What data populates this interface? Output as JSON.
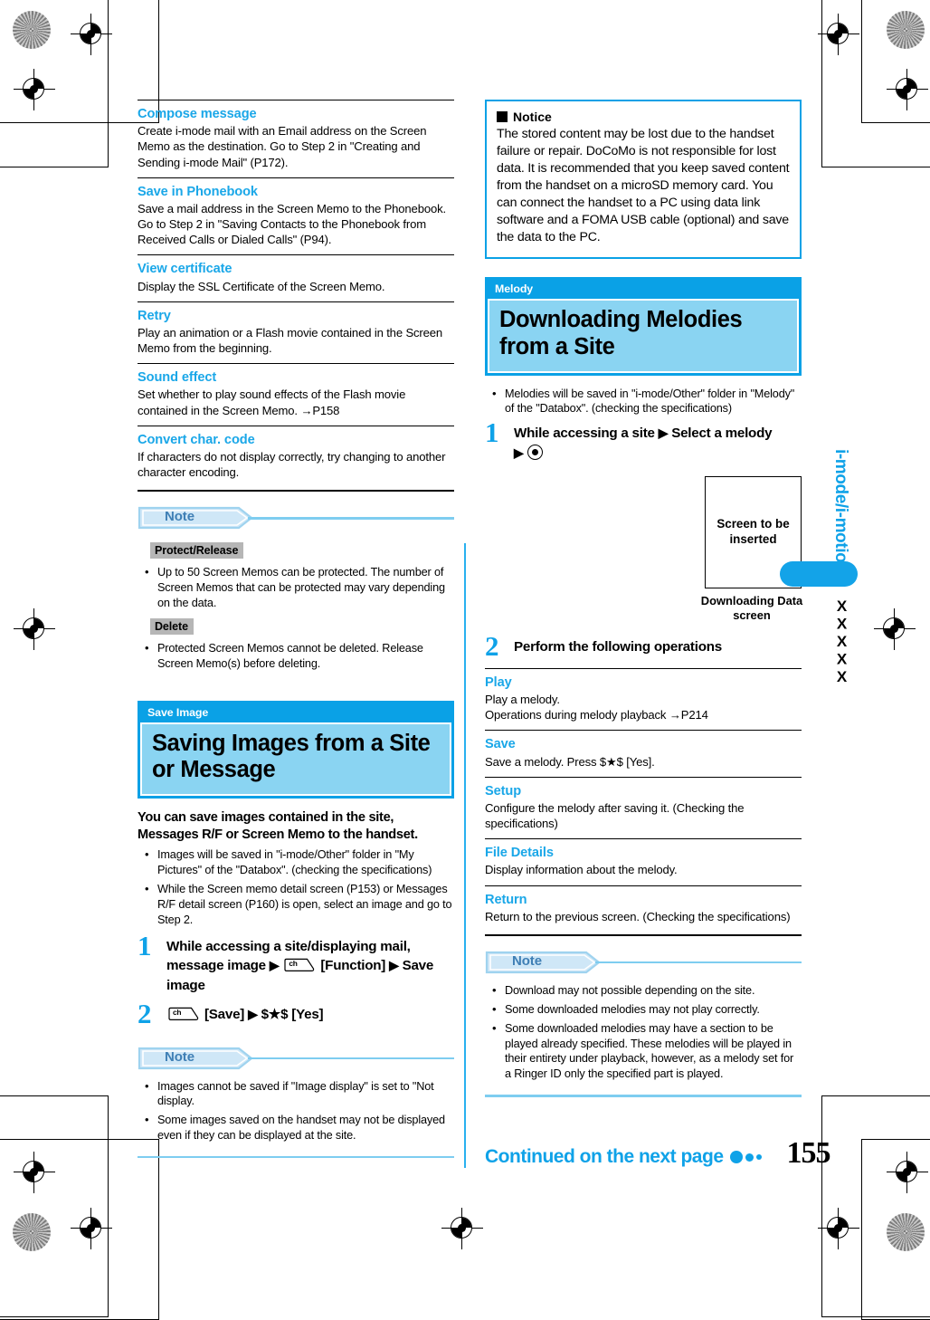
{
  "page": {
    "number": "155",
    "continued_label": "Continued on the next page",
    "side_tab_label": "i-mode/i-motion",
    "side_tab_code": "XXXXX"
  },
  "left_column": {
    "functions": [
      {
        "title": "Compose message",
        "body": "Create i-mode mail with an Email address on the Screen Memo as the destination. Go to Step 2 in \"Creating and Sending i-mode Mail\" (P172)."
      },
      {
        "title": "Save in Phonebook",
        "body": "Save a mail address in the Screen Memo to the Phonebook. Go to Step 2 in \"Saving Contacts to the Phonebook from Received Calls or Dialed Calls\" (P94)."
      },
      {
        "title": "View certificate",
        "body": "Display the SSL Certificate of the Screen Memo."
      },
      {
        "title": "Retry",
        "body": "Play an animation or a Flash movie contained in the Screen Memo from the beginning."
      },
      {
        "title": "Sound effect",
        "body": "Set whether to play sound effects of the Flash movie contained in the Screen Memo. →P158"
      },
      {
        "title": "Convert char. code",
        "body": "If characters do not display correctly, try changing to another character encoding."
      }
    ],
    "note1": {
      "label": "Note",
      "groups": [
        {
          "label": "Protect/Release",
          "items": [
            "Up to 50 Screen Memos can be protected. The number of Screen Memos that can be protected may vary depending on the data."
          ]
        },
        {
          "label": "Delete",
          "items": [
            "Protected Screen Memos cannot be deleted. Release Screen Memo(s) before deleting."
          ]
        }
      ]
    },
    "section": {
      "kicker": "Save Image",
      "title": "Saving Images from a Site or Message"
    },
    "lead": "You can save images contained in the site, Messages R/F or Screen Memo to the handset.",
    "bullets": [
      "Images will be saved in \"i-mode/Other\" folder in \"My Pictures\" of the \"Databox\". (checking the specifications)",
      "While the Screen memo detail screen (P153) or Messages R/F detail screen (P160) is open, select an image and go to Step 2."
    ],
    "steps": [
      {
        "num": "1",
        "part1": "While accessing a site/displaying mail, message image",
        "key1": "ch",
        "part2": "[Function]",
        "part3": "Save image"
      },
      {
        "num": "2",
        "key1": "ch",
        "part1": "[Save]",
        "part2": "$★$ [Yes]"
      }
    ],
    "note2": {
      "label": "Note",
      "items": [
        "Images cannot be saved if \"Image display\" is set to \"Not display.",
        "Some images saved on the handset may not be displayed even if they can be displayed at the site."
      ]
    }
  },
  "right_column": {
    "notice": {
      "heading": "Notice",
      "body": "The stored content may be lost due to the handset failure or repair. DoCoMo is not responsible for lost data.  It is recommended that you keep saved content from the handset on a microSD memory card. You can connect the handset to a PC using data link software and a FOMA USB cable (optional) and save the data to the PC."
    },
    "section": {
      "kicker": "Melody",
      "title": "Downloading Melodies from a Site"
    },
    "bullets": [
      "Melodies will be saved in \"i-mode/Other\" folder in \"Melody\" of the \"Databox\". (checking the specifications)"
    ],
    "step1": {
      "num": "1",
      "part1": "While accessing a site",
      "part2": "Select a melody"
    },
    "figure": {
      "placeholder": "Screen to be inserted",
      "caption": "Downloading Data screen"
    },
    "step2": {
      "num": "2",
      "text": "Perform the following operations"
    },
    "operations": [
      {
        "title": "Play",
        "body": "Play a melody.\nOperations during melody playback →P214"
      },
      {
        "title": "Save",
        "body": "Save a melody. Press $★$ [Yes]."
      },
      {
        "title": "Setup",
        "body": "Configure the melody after saving it. (Checking the specifications)"
      },
      {
        "title": "File Details",
        "body": "Display information about the melody."
      },
      {
        "title": "Return",
        "body": "Return to the previous screen. (Checking the specifications)"
      }
    ],
    "note": {
      "label": "Note",
      "items": [
        "Download may not possible depending on the site.",
        "Some downloaded melodies may not play correctly.",
        "Some downloaded melodies may have a section to be played already specified. These melodies will be played in their entirety under playback, however, as a melody set for a Ringer ID only the specified part is played."
      ]
    }
  },
  "colors": {
    "accent_blue": "#0fa2e8",
    "light_blue": "#8ad4f2",
    "note_blue": "#3f7fb5",
    "gray_label": "#b6b6b6"
  }
}
